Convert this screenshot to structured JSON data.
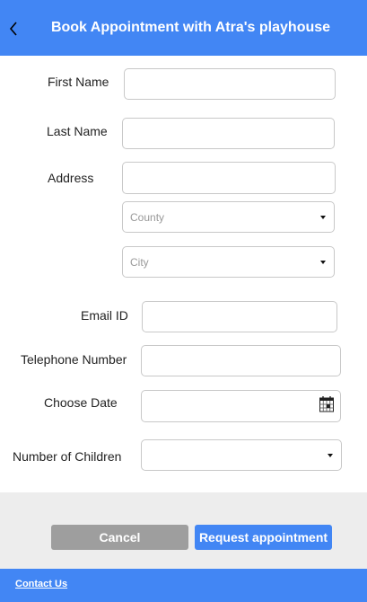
{
  "header": {
    "back_icon": "chevron-left-icon",
    "title": "Book Appointment with Atra's playhouse"
  },
  "form": {
    "first_name": {
      "label": "First Name",
      "value": ""
    },
    "last_name": {
      "label": "Last Name",
      "value": ""
    },
    "address": {
      "label": "Address",
      "value": "",
      "county": {
        "placeholder": "County"
      },
      "city": {
        "placeholder": "City"
      }
    },
    "email": {
      "label": "Email ID",
      "value": ""
    },
    "telephone": {
      "label": "Telephone Number",
      "value": ""
    },
    "date": {
      "label": "Choose Date",
      "value": "",
      "icon": "calendar-icon"
    },
    "children": {
      "label": "Number of Children",
      "value": ""
    }
  },
  "actions": {
    "cancel_label": "Cancel",
    "request_label": "Request appointment"
  },
  "footer": {
    "contact_label": "Contact Us"
  },
  "colors": {
    "primary": "#4286f4",
    "cancel": "#9e9e9e",
    "footer_bg": "#ededed",
    "border": "#c8c8c8"
  }
}
